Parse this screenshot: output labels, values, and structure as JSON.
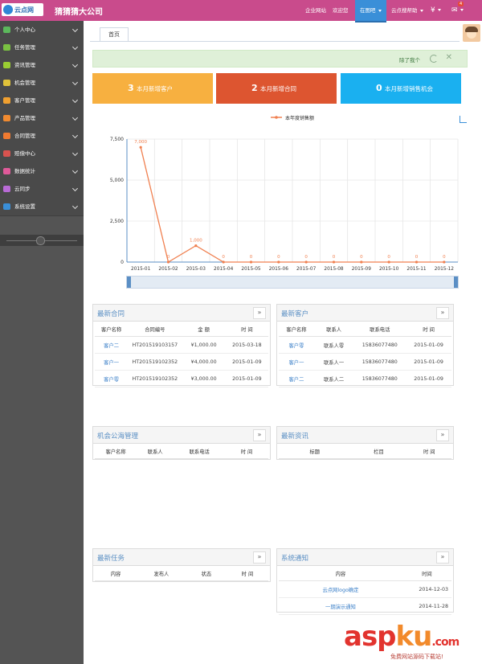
{
  "header": {
    "logo_text": "云点网",
    "company": "猜猜猜大公司",
    "nav": [
      "企业网站",
      "欢迎您",
      "在图吧",
      "云点搜帮助",
      "¥",
      "✉"
    ],
    "badge": "4"
  },
  "sidebar": {
    "items": [
      {
        "label": "个人中心",
        "icon": "user-icon",
        "color": "#5cb85c"
      },
      {
        "label": "任务管理",
        "icon": "edit-icon",
        "color": "#7ac142"
      },
      {
        "label": "资讯管理",
        "icon": "doc-icon",
        "color": "#9acd32"
      },
      {
        "label": "机会管理",
        "icon": "list-icon",
        "color": "#e0c23a"
      },
      {
        "label": "客户管理",
        "icon": "person-icon",
        "color": "#f0a030"
      },
      {
        "label": "产品管理",
        "icon": "gift-icon",
        "color": "#f08a30"
      },
      {
        "label": "合同管理",
        "icon": "folder-icon",
        "color": "#f07a30"
      },
      {
        "label": "赔偿中心",
        "icon": "trash-icon",
        "color": "#d9534f"
      },
      {
        "label": "数据统计",
        "icon": "shuffle-icon",
        "color": "#e05a9a"
      },
      {
        "label": "云同步",
        "icon": "cloud-icon",
        "color": "#b96bd6"
      },
      {
        "label": "系统设置",
        "icon": "gear-icon",
        "color": "#3a8fd8"
      }
    ]
  },
  "tabs": {
    "home": "首页"
  },
  "alert": {
    "text": "除了我个"
  },
  "stats": [
    {
      "num": "3",
      "label": "本月新增客户",
      "color": "#f7b040"
    },
    {
      "num": "2",
      "label": "本月新增合同",
      "color": "#dd5530"
    },
    {
      "num": "0",
      "label": "本月新增销售机会",
      "color": "#1ab0f0"
    }
  ],
  "chart_data": {
    "type": "line",
    "legend": "本年度销售额",
    "categories": [
      "2015-01",
      "2015-02",
      "2015-03",
      "2015-04",
      "2015-05",
      "2015-06",
      "2015-07",
      "2015-08",
      "2015-09",
      "2015-10",
      "2015-11",
      "2015-12"
    ],
    "series": [
      {
        "name": "本年度销售额",
        "values": [
          7000,
          0,
          1000,
          0,
          0,
          0,
          0,
          0,
          0,
          0,
          0,
          0
        ]
      }
    ],
    "point_labels": [
      "7,000",
      "0",
      "1,000",
      "0",
      "0",
      "0",
      "0",
      "0",
      "0",
      "0",
      "0",
      "0"
    ],
    "y_ticks": [
      "0",
      "2,500",
      "5,000",
      "7,500"
    ],
    "ylim": [
      0,
      7500
    ],
    "color": "#f08050"
  },
  "panels": {
    "contracts": {
      "title": "最新合同",
      "more": "»",
      "headers": [
        "客户名称",
        "合同编号",
        "金 额",
        "时 间"
      ],
      "rows": [
        [
          "客户二",
          "HT201519103157",
          "¥1,000.00",
          "2015-03-18"
        ],
        [
          "客户一",
          "HT201519102352",
          "¥4,000.00",
          "2015-01-09"
        ],
        [
          "客户零",
          "HT201519102352",
          "¥3,000.00",
          "2015-01-09"
        ]
      ]
    },
    "customers": {
      "title": "最新客户",
      "more": "»",
      "headers": [
        "客户名称",
        "联系人",
        "联系电话",
        "时 间"
      ],
      "rows": [
        [
          "客户零",
          "联系人零",
          "15836077480",
          "2015-01-09"
        ],
        [
          "客户一",
          "联系人一",
          "15836077480",
          "2015-01-09"
        ],
        [
          "客户二",
          "联系人二",
          "15836077480",
          "2015-01-09"
        ]
      ]
    },
    "opportunity": {
      "title": "机会公海管理",
      "more": "»",
      "headers": [
        "客户名称",
        "联系人",
        "联系电话",
        "时 间"
      ]
    },
    "news": {
      "title": "最新资讯",
      "more": "»",
      "headers": [
        "标题",
        "栏目",
        "时 间"
      ]
    },
    "tasks": {
      "title": "最新任务",
      "more": "»",
      "headers": [
        "内容",
        "发布人",
        "状态",
        "时 间"
      ]
    },
    "notices": {
      "title": "系统通知",
      "more": "»",
      "headers": [
        "内容",
        "时间"
      ],
      "rows": [
        [
          "云点网logo确定",
          "2014-12-03"
        ],
        [
          "一期演示通知",
          "2014-11-28"
        ]
      ]
    }
  },
  "watermark": {
    "text1": "asp",
    "text2": "ku",
    "text3": ".com",
    "sub": "免费网站源码下载站!"
  }
}
